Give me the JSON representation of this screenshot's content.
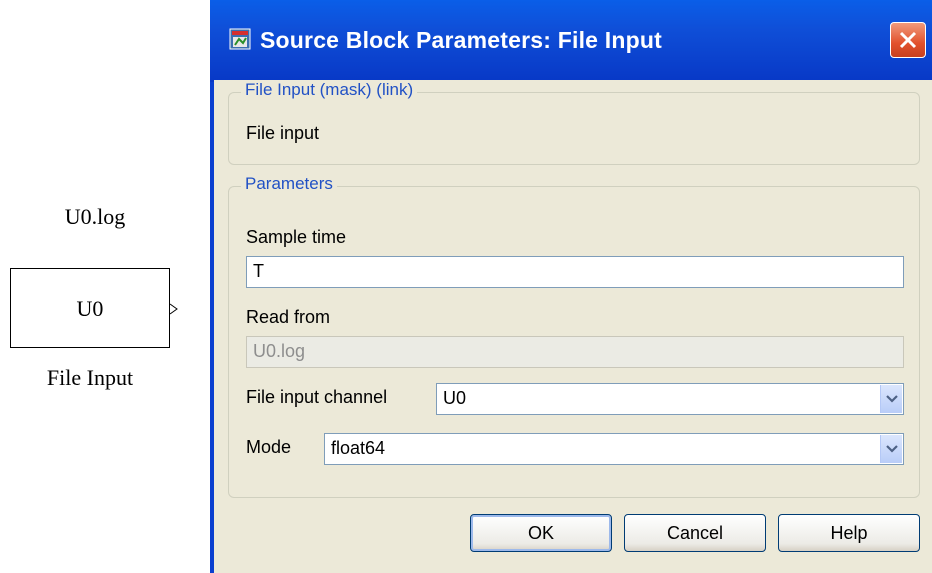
{
  "block": {
    "filename_label": "U0.log",
    "inner_label": "U0",
    "name": "File Input"
  },
  "dialog": {
    "title": "Source Block Parameters: File Input",
    "icons": {
      "app": "simulink-block-icon",
      "close": "close-icon"
    },
    "mask_group": {
      "legend": "File Input (mask) (link)",
      "description": "File input"
    },
    "params_group": {
      "legend": "Parameters",
      "sample_time": {
        "label": "Sample time",
        "value": "T"
      },
      "read_from": {
        "label": "Read from",
        "value": "U0.log"
      },
      "channel": {
        "label": "File input channel",
        "value": "U0"
      },
      "mode": {
        "label": "Mode",
        "value": "float64"
      }
    },
    "buttons": {
      "ok": "OK",
      "cancel": "Cancel",
      "help": "Help"
    }
  }
}
